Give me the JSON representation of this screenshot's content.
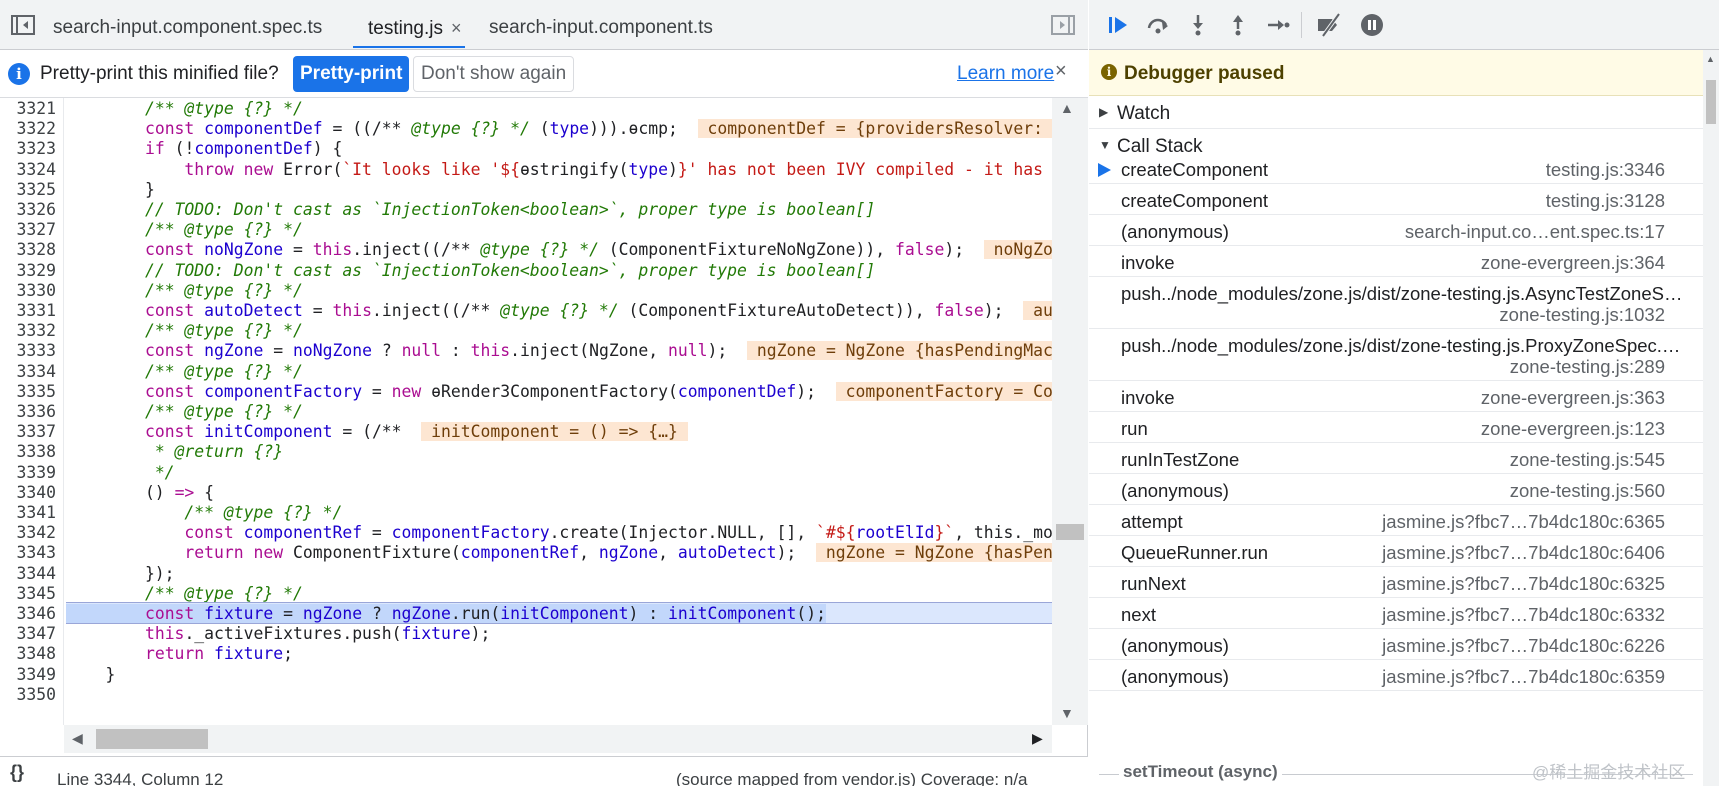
{
  "editor_tabs": [
    {
      "label": "search-input.component.spec.ts",
      "active": false
    },
    {
      "label": "testing.js",
      "active": true,
      "close": "×"
    },
    {
      "label": "search-input.component.ts",
      "active": false
    }
  ],
  "infobar": {
    "message": "Pretty-print this minified file?",
    "pretty_print_label": "Pretty-print",
    "dont_show_label": "Don't show again",
    "learn_more_label": "Learn more",
    "close": "×"
  },
  "code": {
    "highlighted_line": 3346,
    "lines": [
      {
        "n": "3321",
        "segs": [
          [
            "",
            "        "
          ],
          [
            "cmt",
            "/** @type {?} */"
          ]
        ]
      },
      {
        "n": "3322",
        "segs": [
          [
            "",
            "        "
          ],
          [
            "kw",
            "const"
          ],
          [
            "",
            " "
          ],
          [
            "def",
            "componentDef"
          ],
          [
            "",
            " = ((/** "
          ],
          [
            "cmt",
            "@type {?} */"
          ],
          [
            "",
            " ("
          ],
          [
            "def",
            "type"
          ],
          [
            "",
            "))).ɵcmp;  "
          ],
          [
            "iv",
            " componentDef = {providersResolver: "
          ]
        ]
      },
      {
        "n": "3323",
        "segs": [
          [
            "",
            "        "
          ],
          [
            "kw",
            "if"
          ],
          [
            "",
            " (!"
          ],
          [
            "def",
            "componentDef"
          ],
          [
            "",
            ") {"
          ]
        ]
      },
      {
        "n": "3324",
        "segs": [
          [
            "",
            "            "
          ],
          [
            "kw",
            "throw new"
          ],
          [
            "",
            " Error("
          ],
          [
            "str",
            "`It looks like '${"
          ],
          [
            "",
            "ɵstringify("
          ],
          [
            "def",
            "type"
          ],
          [
            "",
            ")"
          ],
          [
            "str",
            "}' has not been IVY compiled - it has no 'ɵcmp' field`"
          ],
          [
            "",
            ");"
          ]
        ]
      },
      {
        "n": "3325",
        "segs": [
          [
            "",
            "        }"
          ]
        ]
      },
      {
        "n": "3326",
        "segs": [
          [
            "",
            "        "
          ],
          [
            "cmt",
            "// TODO: Don't cast as `InjectionToken<boolean>`, proper type is boolean[]"
          ]
        ]
      },
      {
        "n": "3327",
        "segs": [
          [
            "",
            "        "
          ],
          [
            "cmt",
            "/** @type {?} */"
          ]
        ]
      },
      {
        "n": "3328",
        "segs": [
          [
            "",
            "        "
          ],
          [
            "kw",
            "const"
          ],
          [
            "",
            " "
          ],
          [
            "def",
            "noNgZone"
          ],
          [
            "",
            " = "
          ],
          [
            "kw",
            "this"
          ],
          [
            "",
            ".inject((/** "
          ],
          [
            "cmt",
            "@type {?} */"
          ],
          [
            "",
            " (ComponentFixtureNoNgZone)), "
          ],
          [
            "kw",
            "false"
          ],
          [
            "",
            ");  "
          ],
          [
            "iv",
            " noNgZone = false "
          ]
        ]
      },
      {
        "n": "3329",
        "segs": [
          [
            "",
            "        "
          ],
          [
            "cmt",
            "// TODO: Don't cast as `InjectionToken<boolean>`, proper type is boolean[]"
          ]
        ]
      },
      {
        "n": "3330",
        "segs": [
          [
            "",
            "        "
          ],
          [
            "cmt",
            "/** @type {?} */"
          ]
        ]
      },
      {
        "n": "3331",
        "segs": [
          [
            "",
            "        "
          ],
          [
            "kw",
            "const"
          ],
          [
            "",
            " "
          ],
          [
            "def",
            "autoDetect"
          ],
          [
            "",
            " = "
          ],
          [
            "kw",
            "this"
          ],
          [
            "",
            ".inject((/** "
          ],
          [
            "cmt",
            "@type {?} */"
          ],
          [
            "",
            " (ComponentFixtureAutoDetect)), "
          ],
          [
            "kw",
            "false"
          ],
          [
            "",
            ");  "
          ],
          [
            "iv",
            " autoDetect = false "
          ]
        ]
      },
      {
        "n": "3332",
        "segs": [
          [
            "",
            "        "
          ],
          [
            "cmt",
            "/** @type {?} */"
          ]
        ]
      },
      {
        "n": "3333",
        "segs": [
          [
            "",
            "        "
          ],
          [
            "kw",
            "const"
          ],
          [
            "",
            " "
          ],
          [
            "def",
            "ngZone"
          ],
          [
            "",
            " = "
          ],
          [
            "def",
            "noNgZone"
          ],
          [
            "",
            " ? "
          ],
          [
            "kw",
            "null"
          ],
          [
            "",
            " : "
          ],
          [
            "kw",
            "this"
          ],
          [
            "",
            ".inject(NgZone, "
          ],
          [
            "kw",
            "null"
          ],
          [
            "",
            ");  "
          ],
          [
            "iv",
            " ngZone = NgZone {hasPendingMacrotasks: "
          ]
        ]
      },
      {
        "n": "3334",
        "segs": [
          [
            "",
            "        "
          ],
          [
            "cmt",
            "/** @type {?} */"
          ]
        ]
      },
      {
        "n": "3335",
        "segs": [
          [
            "",
            "        "
          ],
          [
            "kw",
            "const"
          ],
          [
            "",
            " "
          ],
          [
            "def",
            "componentFactory"
          ],
          [
            "",
            " = "
          ],
          [
            "kw",
            "new"
          ],
          [
            "",
            " ɵRender3ComponentFactory("
          ],
          [
            "def",
            "componentDef"
          ],
          [
            "",
            ");  "
          ],
          [
            "iv",
            " componentFactory = ComponentFactory "
          ]
        ]
      },
      {
        "n": "3336",
        "segs": [
          [
            "",
            "        "
          ],
          [
            "cmt",
            "/** @type {?} */"
          ]
        ]
      },
      {
        "n": "3337",
        "segs": [
          [
            "",
            "        "
          ],
          [
            "kw",
            "const"
          ],
          [
            "",
            " "
          ],
          [
            "def",
            "initComponent"
          ],
          [
            "",
            " = (/**  "
          ],
          [
            "iv",
            " initComponent = () => {…} "
          ]
        ]
      },
      {
        "n": "3338",
        "segs": [
          [
            "",
            "         "
          ],
          [
            "cmt",
            "* @return {?}"
          ]
        ]
      },
      {
        "n": "3339",
        "segs": [
          [
            "",
            "         "
          ],
          [
            "cmt",
            "*/"
          ]
        ]
      },
      {
        "n": "3340",
        "segs": [
          [
            "",
            "        () "
          ],
          [
            "kw",
            "=>"
          ],
          [
            "",
            " {"
          ]
        ]
      },
      {
        "n": "3341",
        "segs": [
          [
            "",
            "            "
          ],
          [
            "cmt",
            "/** @type {?} */"
          ]
        ]
      },
      {
        "n": "3342",
        "segs": [
          [
            "",
            "            "
          ],
          [
            "kw",
            "const"
          ],
          [
            "",
            " "
          ],
          [
            "def",
            "componentRef"
          ],
          [
            "",
            " = "
          ],
          [
            "def",
            "componentFactory"
          ],
          [
            "",
            ".create(Injector.NULL, [], "
          ],
          [
            "str",
            "`#${"
          ],
          [
            "def",
            "rootElId"
          ],
          [
            "str",
            "}`"
          ],
          [
            "",
            ", this._moduleRef);"
          ]
        ]
      },
      {
        "n": "3343",
        "segs": [
          [
            "",
            "            "
          ],
          [
            "kw",
            "return new"
          ],
          [
            "",
            " ComponentFixture("
          ],
          [
            "def",
            "componentRef"
          ],
          [
            "",
            ", "
          ],
          [
            "def",
            "ngZone"
          ],
          [
            "",
            ", "
          ],
          [
            "def",
            "autoDetect"
          ],
          [
            "",
            ");  "
          ],
          [
            "iv",
            " ngZone = NgZone {hasPendingMacrotasks: "
          ]
        ]
      },
      {
        "n": "3344",
        "segs": [
          [
            "",
            "        });"
          ]
        ]
      },
      {
        "n": "3345",
        "segs": [
          [
            "",
            "        "
          ],
          [
            "cmt",
            "/** @type {?} */"
          ]
        ]
      },
      {
        "n": "3346",
        "segs": [
          [
            "sel",
            "        "
          ],
          [
            "sel kw",
            "const"
          ],
          [
            "sel",
            " "
          ],
          [
            "sel def",
            "fixture"
          ],
          [
            "sel",
            " = "
          ],
          [
            "sel def",
            "ngZone"
          ],
          [
            "sel",
            " ? "
          ],
          [
            "sel def",
            "ngZone"
          ],
          [
            "sel",
            ".run("
          ],
          [
            "sel def",
            "initComponent"
          ],
          [
            "sel",
            ") : "
          ],
          [
            "sel def",
            "initComponent"
          ],
          [
            "sel",
            "();"
          ]
        ]
      },
      {
        "n": "3347",
        "segs": [
          [
            "",
            "        "
          ],
          [
            "kw",
            "this"
          ],
          [
            "",
            "._activeFixtures.push("
          ],
          [
            "def",
            "fixture"
          ],
          [
            "",
            ");"
          ]
        ]
      },
      {
        "n": "3348",
        "segs": [
          [
            "",
            "        "
          ],
          [
            "kw",
            "return"
          ],
          [
            "",
            " "
          ],
          [
            "def",
            "fixture"
          ],
          [
            "",
            ";"
          ]
        ]
      },
      {
        "n": "3349",
        "segs": [
          [
            "",
            "    }"
          ]
        ]
      },
      {
        "n": "3350",
        "segs": [
          [
            "",
            ""
          ]
        ]
      }
    ]
  },
  "status": {
    "braces": "{}",
    "position": "Line 3344, Column 12",
    "source": "(source mapped from vendor.js)  Coverage: n/a"
  },
  "debugger": {
    "paused_message": "Debugger paused",
    "watch_label": "Watch",
    "call_stack_label": "Call Stack",
    "frames": [
      {
        "fn": "createComponent",
        "loc": "testing.js:3346",
        "current": true
      },
      {
        "fn": "createComponent",
        "loc": "testing.js:3128"
      },
      {
        "fn": "(anonymous)",
        "loc": "search-input.co…ent.spec.ts:17"
      },
      {
        "fn": "invoke",
        "loc": "zone-evergreen.js:364"
      },
      {
        "fn": "push../node_modules/zone.js/dist/zone-testing.js.AsyncTestZoneS…",
        "loc": "zone-testing.js:1032",
        "two_line": true
      },
      {
        "fn": "push../node_modules/zone.js/dist/zone-testing.js.ProxyZoneSpec.…",
        "loc": "zone-testing.js:289",
        "two_line": true
      },
      {
        "fn": "invoke",
        "loc": "zone-evergreen.js:363"
      },
      {
        "fn": "run",
        "loc": "zone-evergreen.js:123"
      },
      {
        "fn": "runInTestZone",
        "loc": "zone-testing.js:545"
      },
      {
        "fn": "(anonymous)",
        "loc": "zone-testing.js:560"
      },
      {
        "fn": "attempt",
        "loc": "jasmine.js?fbc7…7b4dc180c:6365"
      },
      {
        "fn": "QueueRunner.run",
        "loc": "jasmine.js?fbc7…7b4dc180c:6406"
      },
      {
        "fn": "runNext",
        "loc": "jasmine.js?fbc7…7b4dc180c:6325"
      },
      {
        "fn": "next",
        "loc": "jasmine.js?fbc7…7b4dc180c:6332"
      },
      {
        "fn": "(anonymous)",
        "loc": "jasmine.js?fbc7…7b4dc180c:6226"
      },
      {
        "fn": "(anonymous)",
        "loc": "jasmine.js?fbc7…7b4dc180c:6359"
      }
    ],
    "async_label": "setTimeout (async)"
  },
  "watermark": "@稀土掘金技术社区",
  "colors": {
    "accent": "#1a73e8",
    "paused_bg": "#fffbe6",
    "highlight": "#dbe7fd",
    "inline_value_bg": "#fde6d2"
  }
}
